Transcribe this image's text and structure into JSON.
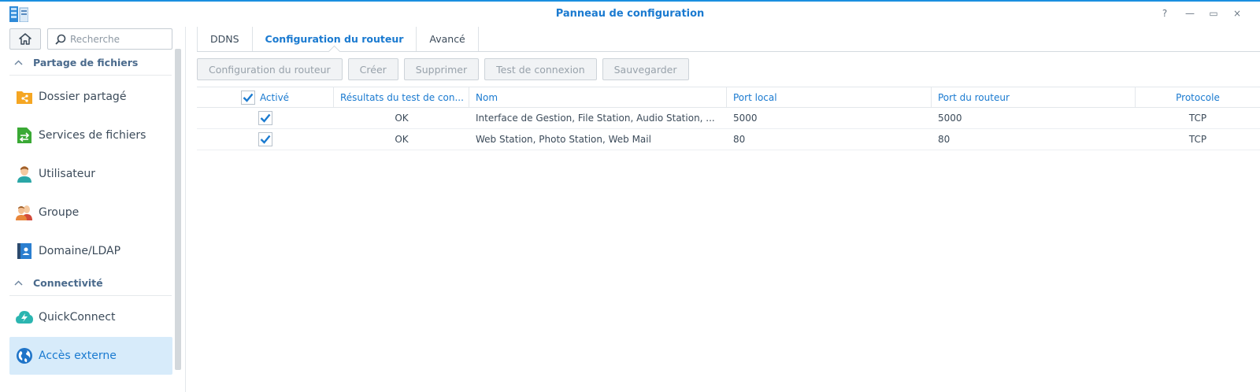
{
  "window": {
    "title": "Panneau de configuration",
    "controls": {
      "help": "?",
      "minimize": "—",
      "maximize": "▭",
      "close": "×"
    }
  },
  "sidebar": {
    "search_placeholder": "Recherche",
    "sections": [
      {
        "label": "Partage de fichiers"
      },
      {
        "label": "Connectivité"
      }
    ],
    "items": [
      {
        "label": "Dossier partagé",
        "icon": "shared-folder-icon"
      },
      {
        "label": "Services de fichiers",
        "icon": "file-services-icon"
      },
      {
        "label": "Utilisateur",
        "icon": "user-icon"
      },
      {
        "label": "Groupe",
        "icon": "group-icon"
      },
      {
        "label": "Domaine/LDAP",
        "icon": "domain-ldap-icon"
      },
      {
        "label": "QuickConnect",
        "icon": "quickconnect-icon"
      },
      {
        "label": "Accès externe",
        "icon": "external-access-icon",
        "active": true
      }
    ]
  },
  "tabs": [
    {
      "label": "DDNS"
    },
    {
      "label": "Configuration du routeur",
      "active": true
    },
    {
      "label": "Avancé"
    }
  ],
  "toolbar": {
    "router_config": "Configuration du routeur",
    "create": "Créer",
    "delete": "Supprimer",
    "test": "Test de connexion",
    "save": "Sauvegarder"
  },
  "table": {
    "columns": {
      "enabled": "Activé",
      "test_result": "Résultats du test de con...",
      "name": "Nom",
      "local_port": "Port local",
      "router_port": "Port du routeur",
      "protocol": "Protocole"
    },
    "rows": [
      {
        "enabled": true,
        "test_result": "OK",
        "name": "Interface de Gestion, File Station, Audio Station, ...",
        "local_port": "5000",
        "router_port": "5000",
        "protocol": "TCP"
      },
      {
        "enabled": true,
        "test_result": "OK",
        "name": "Web Station, Photo Station, Web Mail",
        "local_port": "80",
        "router_port": "80",
        "protocol": "TCP"
      }
    ]
  },
  "colors": {
    "accent": "#1a7ad0",
    "active_bg": "#d7ebfa",
    "window_border": "#1a8fe0"
  }
}
